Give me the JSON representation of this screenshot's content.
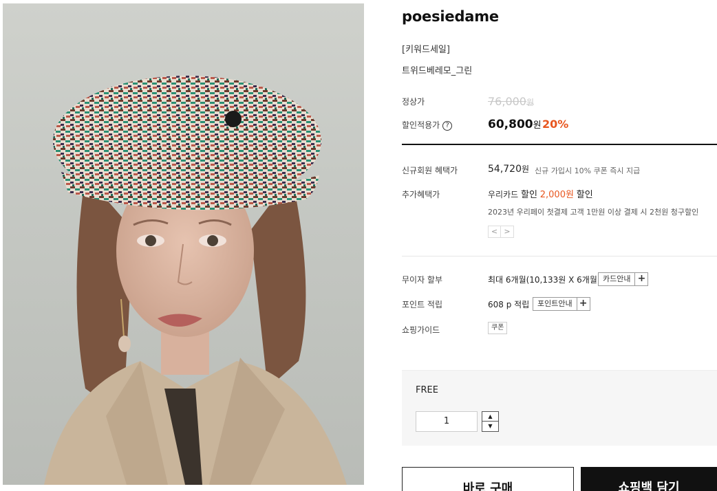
{
  "image": {
    "alt": "model wearing green tweed beret"
  },
  "product": {
    "brand": "poesiedame",
    "tag": "[키워드세일]",
    "name": "트위드베레모_그린"
  },
  "price": {
    "regular_label": "정상가",
    "regular_value": "76,000",
    "regular_unit": "원",
    "discount_label": "할인적용가",
    "help_icon": "?",
    "sale_value": "60,800",
    "sale_unit": "원",
    "discount_rate": "20%"
  },
  "benefits": {
    "member_label": "신규회원 혜택가",
    "member_price": "54,720",
    "member_unit": "원",
    "member_note": "신규 가입시 10% 쿠폰 즉시 지급",
    "extra_label": "추가혜택가",
    "card_text": "우리카드",
    "card_discount_word": "할인",
    "card_amount": "2,000원",
    "card_suffix": "할인",
    "promo_text": "2023년 우리페이 첫결제 고객 1만원 이상 결제 시 2천원 청구할인",
    "prev_icon": "<",
    "next_icon": ">"
  },
  "installment": {
    "label": "무이자 할부",
    "value": "최대 6개월(10,133원 X 6개월)",
    "button_label": "카드안내",
    "plus": "+"
  },
  "points": {
    "label": "포인트 적립",
    "value": "608 p 적립",
    "button_label": "포인트안내",
    "plus": "+"
  },
  "guide": {
    "label": "쇼핑가이드",
    "coupon_label": "쿠폰"
  },
  "option": {
    "name": "FREE",
    "quantity": "1",
    "up": "▲",
    "down": "▼"
  },
  "actions": {
    "buy_now": "바로 구매",
    "add_to_cart": "쇼핑백 담기"
  },
  "colors": {
    "accent": "#e8561f",
    "dark": "#111111"
  }
}
